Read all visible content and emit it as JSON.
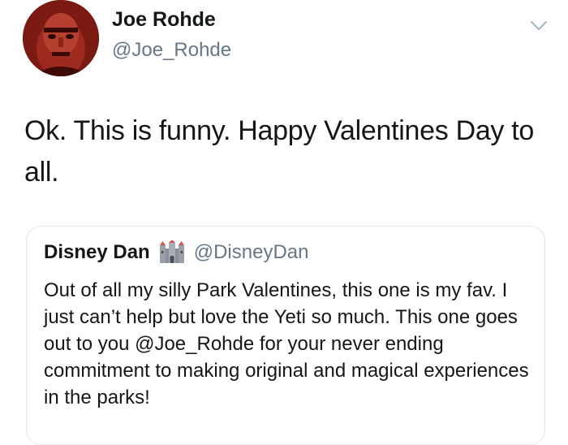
{
  "tweet": {
    "author": {
      "name": "Joe Rohde",
      "handle": "@Joe_Rohde"
    },
    "text": "Ok. This is funny. Happy Valentines Day to all.",
    "menu_icon": "chevron-down-icon"
  },
  "quoted_tweet": {
    "author": {
      "name": "Disney Dan",
      "badge_icon": "castle-emoji-icon",
      "handle": "@DisneyDan"
    },
    "text": "Out of all my silly Park Valentines, this one is my fav. I just can’t help but love the Yeti so much. This one goes out to you @Joe_Rohde for your never ending commitment to making original and magical experiences in the parks!"
  },
  "colors": {
    "text_primary": "#14171a",
    "text_secondary": "#657786",
    "border": "#e1e8ed",
    "chevron": "#aab8c2"
  }
}
